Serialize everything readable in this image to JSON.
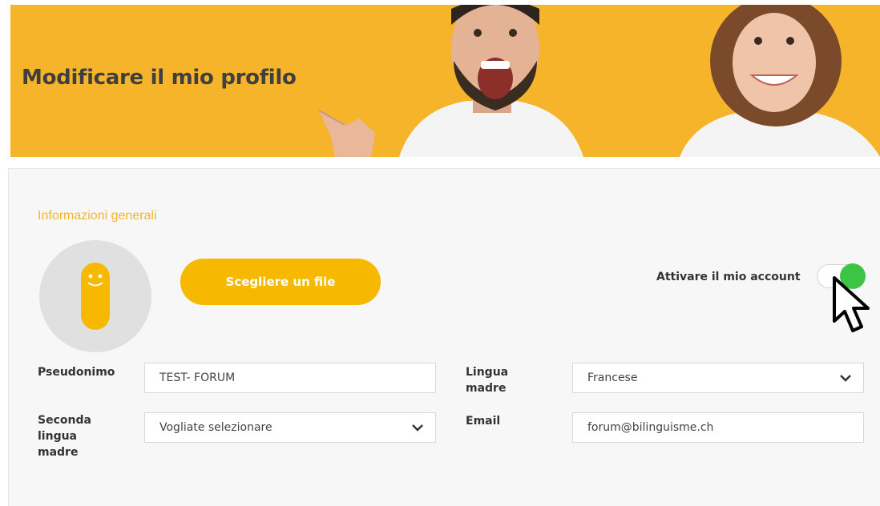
{
  "banner": {
    "title": "Modificare il mio profilo"
  },
  "section": {
    "title": "Informazioni generali"
  },
  "upload": {
    "button_label": "Scegliere un file"
  },
  "account_toggle": {
    "label": "Attivare il mio account",
    "checked": true,
    "on_color": "#3cc444"
  },
  "form": {
    "pseudonym": {
      "label": "Pseudonimo",
      "value": "TEST- FORUM"
    },
    "native_language": {
      "label": "Lingua madre",
      "selected": "Francese"
    },
    "second_native_language": {
      "label": "Seconda lingua madre",
      "selected": "Vogliate selezionare"
    },
    "email": {
      "label": "Email",
      "value": "forum@bilinguisme.ch"
    }
  },
  "icons": [
    "smiley-capsule-avatar-icon",
    "chevron-down-icon",
    "mouse-pointer-icon"
  ],
  "colors": {
    "accent": "#f6b42a",
    "button": "#f7b800",
    "card_bg": "#f7f7f7"
  }
}
